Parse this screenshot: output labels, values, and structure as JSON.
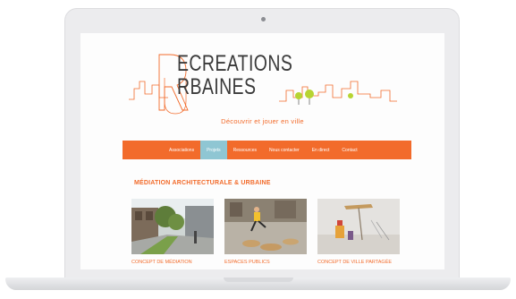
{
  "logo": {
    "line1": "ECREATIONS",
    "line2": "RBAINES",
    "initial_r": "R",
    "initial_u": "U"
  },
  "tagline": "Découvrir et jouer en ville",
  "nav": {
    "items": [
      {
        "label": "Associations",
        "active": false
      },
      {
        "label": "Projets",
        "active": true
      },
      {
        "label": "Ressources",
        "active": false
      },
      {
        "label": "Nous contacter",
        "active": false
      },
      {
        "label": "En direct",
        "active": false
      },
      {
        "label": "Contact",
        "active": false
      }
    ]
  },
  "section": {
    "title": "MÉDIATION ARCHITECTURALE & URBAINE"
  },
  "cards": [
    {
      "caption": "CONCEPT DE MÉDIATION"
    },
    {
      "caption": "ESPACES PUBLICS"
    },
    {
      "caption": "CONCEPT DE VILLE PARTAGÉE"
    }
  ],
  "colors": {
    "accent": "#f26b2b",
    "active_tab": "#8fc6d3",
    "logo_green": "#b7d432"
  }
}
